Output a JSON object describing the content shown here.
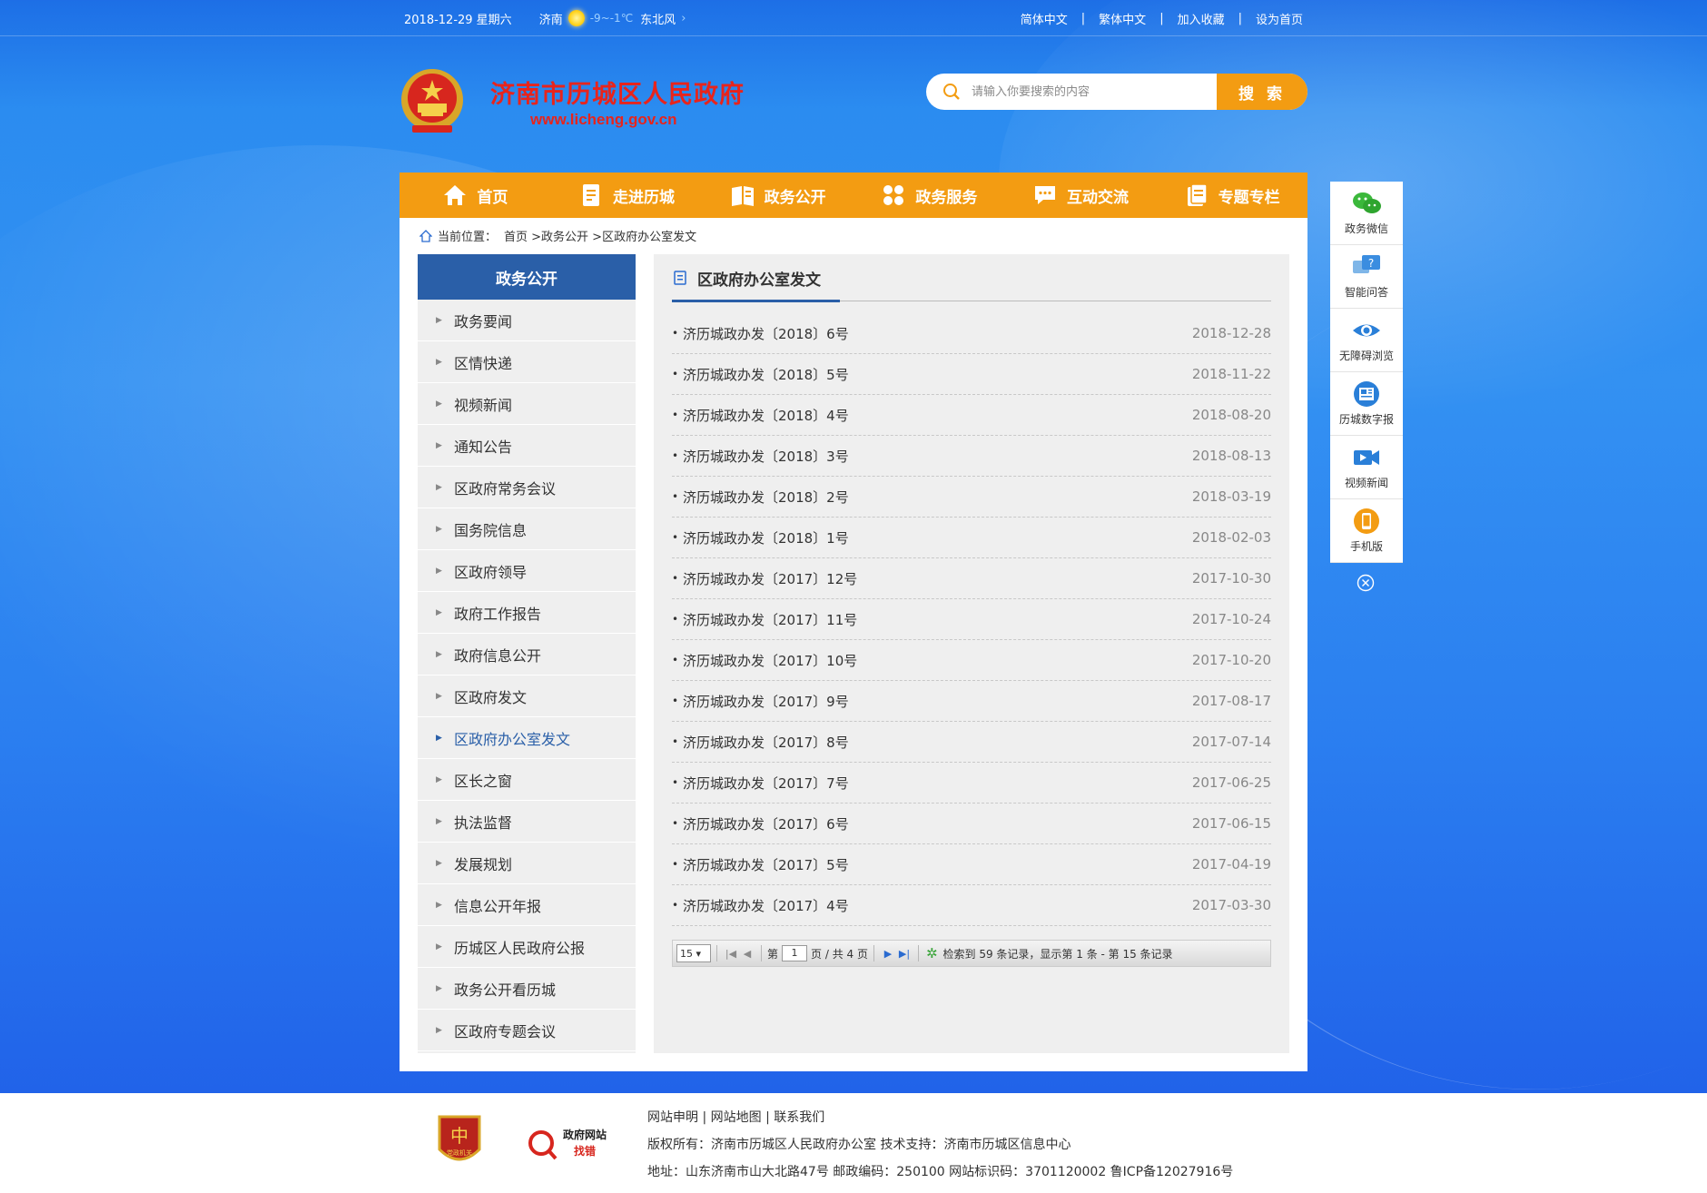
{
  "topbar": {
    "date": "2018-12-29 星期六",
    "city": "济南",
    "temp": "-9~-1℃",
    "wind": "东北风",
    "links": [
      "简体中文",
      "繁体中文",
      "加入收藏",
      "设为首页"
    ]
  },
  "header": {
    "title": "济南市历城区人民政府",
    "url": "www.licheng.gov.cn",
    "search_placeholder": "请输入你要搜索的内容",
    "search_button": "搜 索"
  },
  "nav": [
    "首页",
    "走进历城",
    "政务公开",
    "政务服务",
    "互动交流",
    "专题专栏"
  ],
  "breadcrumb": {
    "prefix": "当前位置：",
    "path": "首页 >政务公开 >区政府办公室发文"
  },
  "sidebar": {
    "title": "政务公开",
    "active_index": 10,
    "items": [
      "政务要闻",
      "区情快递",
      "视频新闻",
      "通知公告",
      "区政府常务会议",
      "国务院信息",
      "区政府领导",
      "政府工作报告",
      "政府信息公开",
      "区政府发文",
      "区政府办公室发文",
      "区长之窗",
      "执法监督",
      "发展规划",
      "信息公开年报",
      "历城区人民政府公报",
      "政务公开看历城",
      "区政府专题会议"
    ]
  },
  "content": {
    "title": "区政府办公室发文",
    "rows": [
      {
        "title": "济历城政办发〔2018〕6号",
        "date": "2018-12-28"
      },
      {
        "title": "济历城政办发〔2018〕5号",
        "date": "2018-11-22"
      },
      {
        "title": "济历城政办发〔2018〕4号",
        "date": "2018-08-20"
      },
      {
        "title": "济历城政办发〔2018〕3号",
        "date": "2018-08-13"
      },
      {
        "title": "济历城政办发〔2018〕2号",
        "date": "2018-03-19"
      },
      {
        "title": "济历城政办发〔2018〕1号",
        "date": "2018-02-03"
      },
      {
        "title": "济历城政办发〔2017〕12号",
        "date": "2017-10-30"
      },
      {
        "title": "济历城政办发〔2017〕11号",
        "date": "2017-10-24"
      },
      {
        "title": "济历城政办发〔2017〕10号",
        "date": "2017-10-20"
      },
      {
        "title": "济历城政办发〔2017〕9号",
        "date": "2017-08-17"
      },
      {
        "title": "济历城政办发〔2017〕8号",
        "date": "2017-07-14"
      },
      {
        "title": "济历城政办发〔2017〕7号",
        "date": "2017-06-25"
      },
      {
        "title": "济历城政办发〔2017〕6号",
        "date": "2017-06-15"
      },
      {
        "title": "济历城政办发〔2017〕5号",
        "date": "2017-04-19"
      },
      {
        "title": "济历城政办发〔2017〕4号",
        "date": "2017-03-30"
      }
    ]
  },
  "pager": {
    "page_size": "15",
    "page_label_pre": "第",
    "page": "1",
    "page_label_post": "页 / 共 4 页",
    "summary": "检索到 59 条记录，显示第 1 条 - 第 15 条记录"
  },
  "float_bar": [
    "政务微信",
    "智能问答",
    "无障碍浏览",
    "历城数字报",
    "视频新闻",
    "手机版"
  ],
  "footer": {
    "links_line": "网站申明 | 网站地图 | 联系我们",
    "copyright": "版权所有：济南市历城区人民政府办公室 技术支持：济南市历城区信息中心",
    "address": "地址：山东济南市山大北路47号 邮政编码：250100 网站标识码：3701120002 鲁ICP备12027916号",
    "badge1_text": "党政机关",
    "badge2_line1": "政府网站",
    "badge2_line2": "找错"
  }
}
